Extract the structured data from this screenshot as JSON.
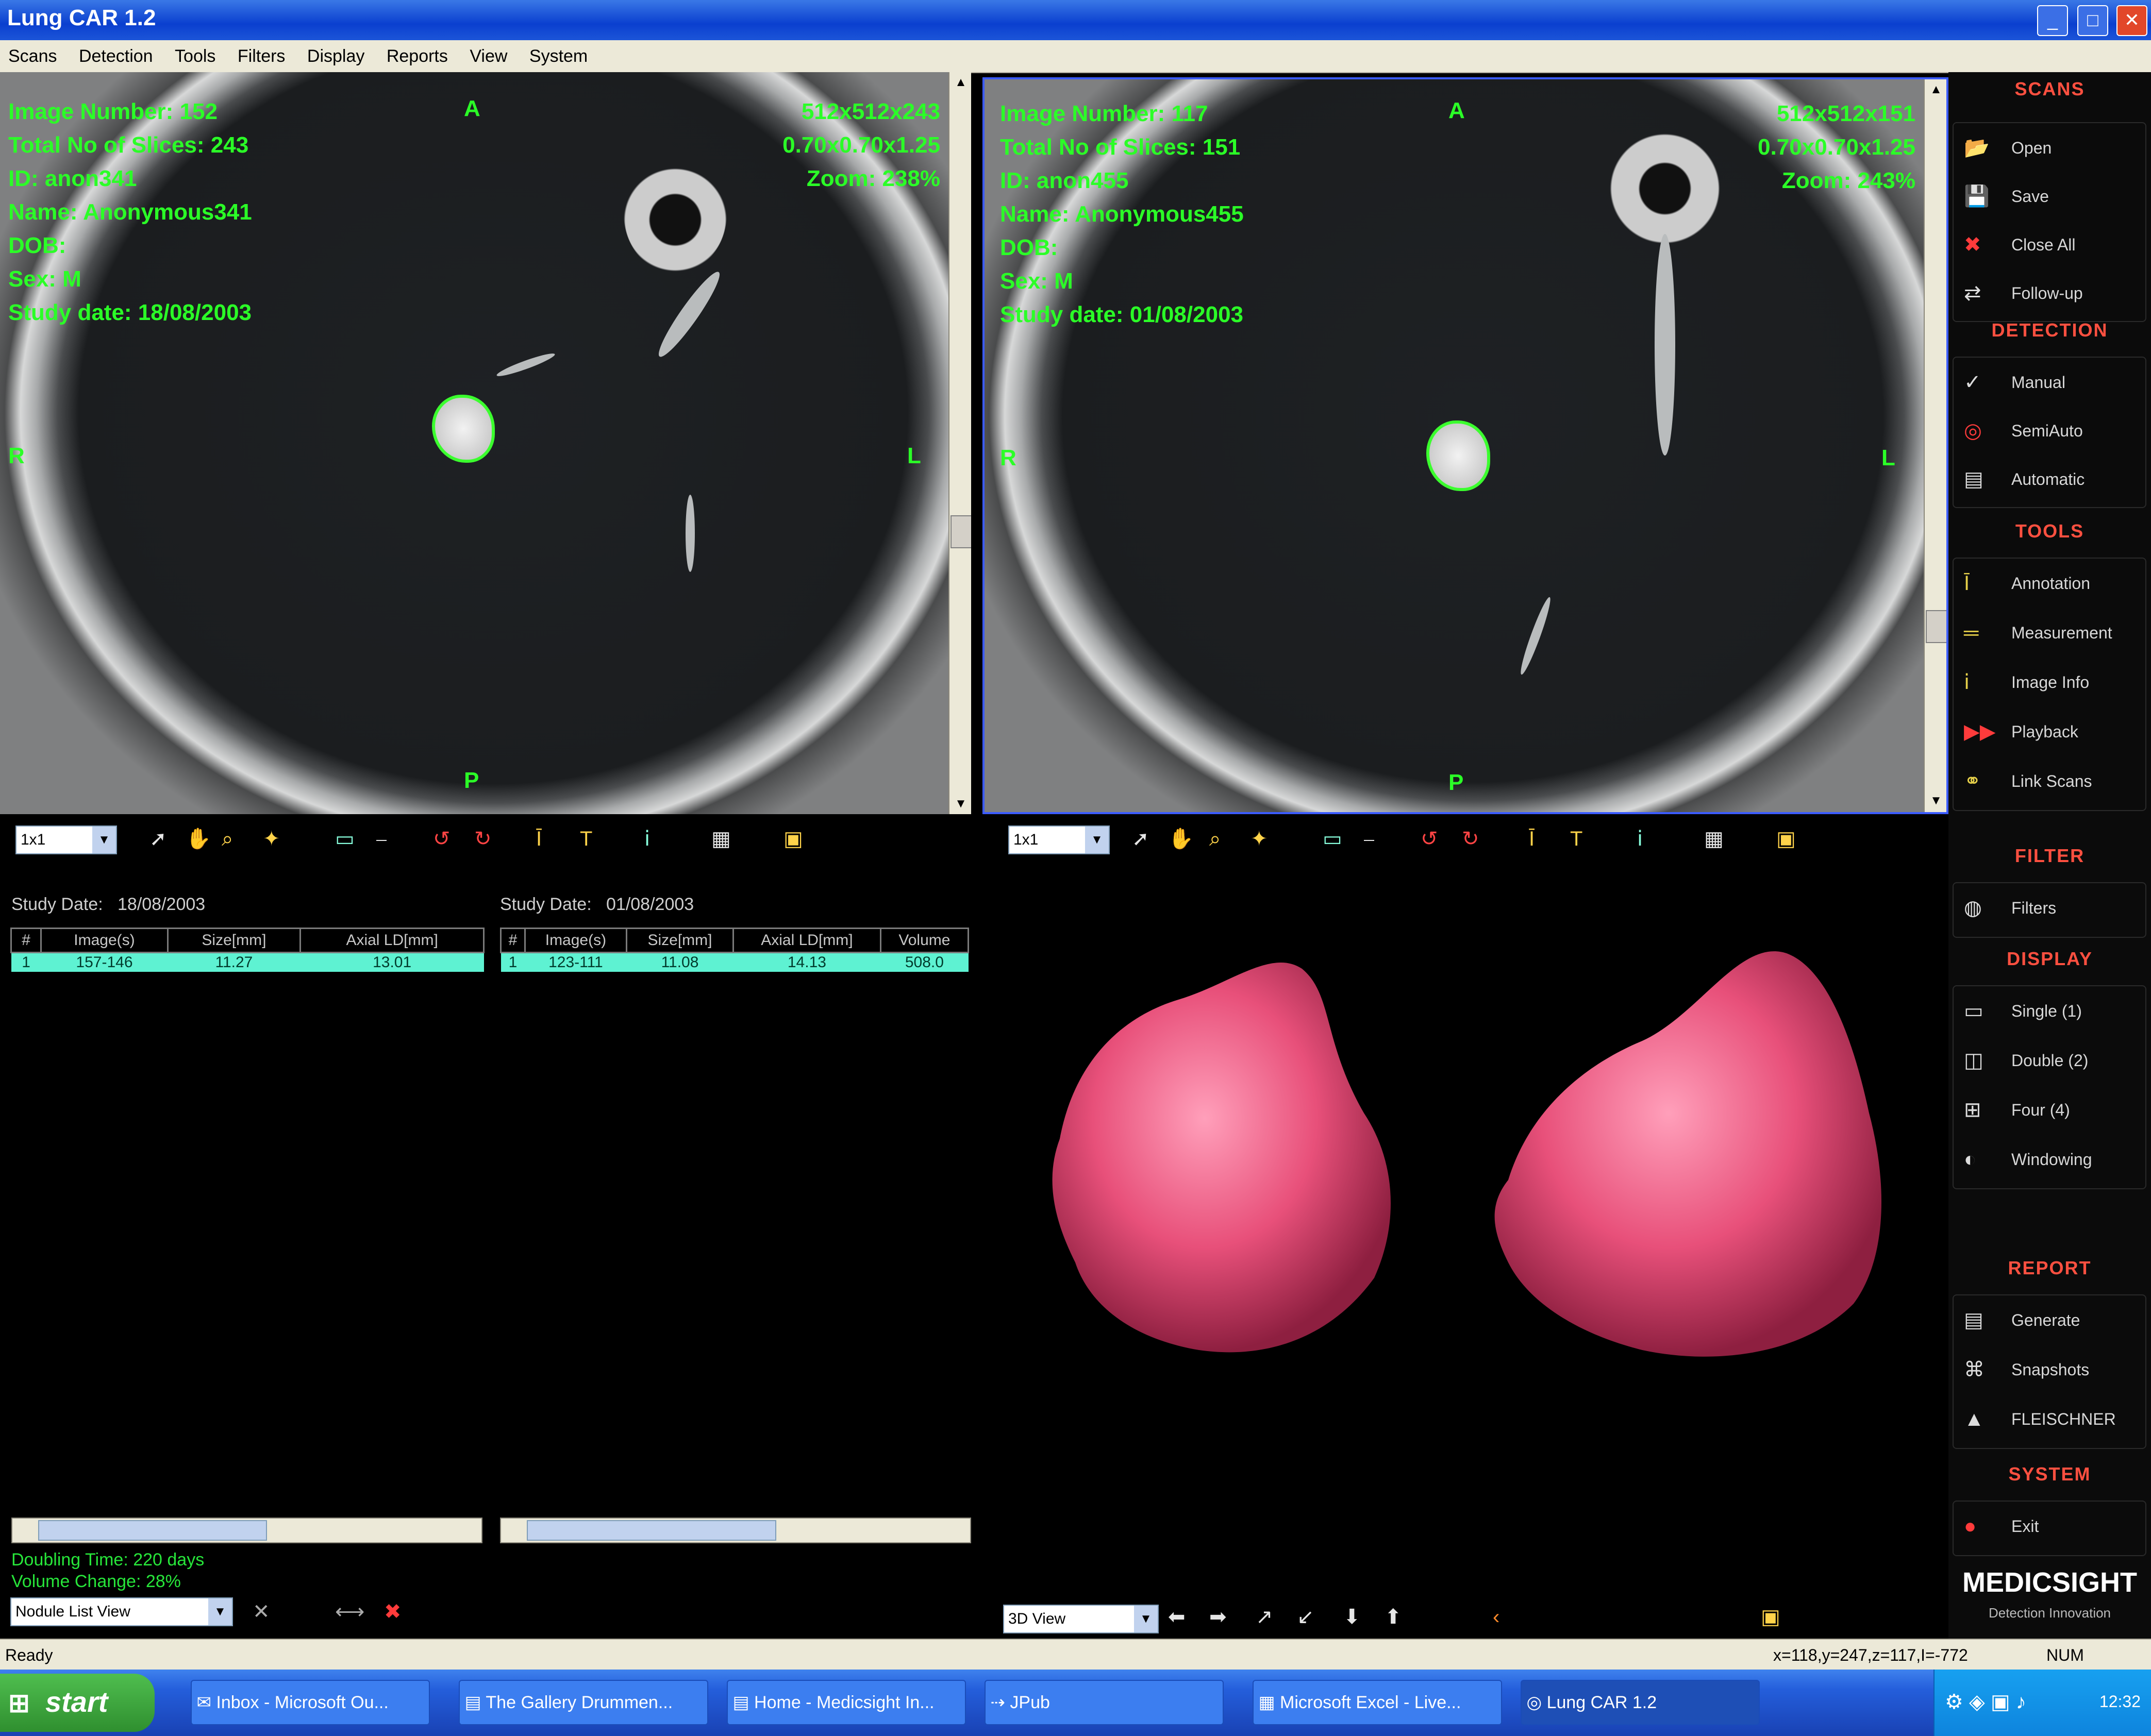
{
  "window": {
    "title": "Lung CAR 1.2",
    "buttons": [
      "_",
      "□",
      "✕"
    ]
  },
  "menu": [
    "Scans",
    "Detection",
    "Tools",
    "Filters",
    "Display",
    "Reports",
    "View",
    "System"
  ],
  "viewer_left": {
    "overlay_left": [
      "Image Number: 152",
      "Total No of Slices: 243",
      "ID: anon341",
      "Name: Anonymous341",
      "DOB:",
      "Sex: M",
      "Study date: 18/08/2003"
    ],
    "overlay_right": [
      "512x512x243",
      "0.70x0.70x1.25",
      "Zoom: 238%"
    ],
    "orient": {
      "top": "A",
      "left": "R",
      "right": "L",
      "bottom": "P"
    },
    "zoom_select": "1x1"
  },
  "viewer_right": {
    "overlay_left": [
      "Image Number: 117",
      "Total No of Slices: 151",
      "ID: anon455",
      "Name: Anonymous455",
      "DOB:",
      "Sex: M",
      "Study date: 01/08/2003"
    ],
    "overlay_right": [
      "512x512x151",
      "0.70x0.70x1.25",
      "Zoom: 243%"
    ],
    "orient": {
      "top": "A",
      "left": "R",
      "right": "L",
      "bottom": "P"
    },
    "zoom_select": "1x1"
  },
  "sidebar": {
    "scans": {
      "title": "SCANS",
      "items": [
        {
          "label": "Open",
          "icon": "folder-open-icon",
          "glyph": "📂"
        },
        {
          "label": "Save",
          "icon": "save-icon",
          "glyph": "💾"
        },
        {
          "label": "Close All",
          "icon": "close-icon",
          "glyph": "✖"
        },
        {
          "label": "Follow-up",
          "icon": "follow-up-icon",
          "glyph": "⇄"
        }
      ]
    },
    "detection": {
      "title": "DETECTION",
      "items": [
        {
          "label": "Manual",
          "icon": "manual-icon",
          "glyph": "✓"
        },
        {
          "label": "SemiAuto",
          "icon": "semi-auto-icon",
          "glyph": "◎"
        },
        {
          "label": "Automatic",
          "icon": "automatic-icon",
          "glyph": "▤"
        }
      ]
    },
    "tools": {
      "title": "TOOLS",
      "items": [
        {
          "label": "Annotation",
          "icon": "annotation-icon",
          "glyph": "Ī"
        },
        {
          "label": "Measurement",
          "icon": "measurement-icon",
          "glyph": "═"
        },
        {
          "label": "Image Info",
          "icon": "image-info-icon",
          "glyph": "ⅰ"
        },
        {
          "label": "Playback",
          "icon": "playback-icon",
          "glyph": "▶▶"
        },
        {
          "label": "Link Scans",
          "icon": "link-scans-icon",
          "glyph": "⚭"
        }
      ]
    },
    "filter": {
      "title": "FILTER",
      "items": [
        {
          "label": "Filters",
          "icon": "filter-icon",
          "glyph": "◍"
        }
      ]
    },
    "display": {
      "title": "DISPLAY",
      "items": [
        {
          "label": "Single (1)",
          "icon": "single-view-icon",
          "glyph": "▭"
        },
        {
          "label": "Double (2)",
          "icon": "double-view-icon",
          "glyph": "◫"
        },
        {
          "label": "Four (4)",
          "icon": "four-view-icon",
          "glyph": "⊞"
        },
        {
          "label": "Windowing",
          "icon": "windowing-icon",
          "glyph": "◐"
        }
      ]
    },
    "report": {
      "title": "REPORT",
      "items": [
        {
          "label": "Generate",
          "icon": "generate-report-icon",
          "glyph": "▤"
        },
        {
          "label": "Snapshots",
          "icon": "snapshots-icon",
          "glyph": "⌘"
        },
        {
          "label": "FLEISCHNER",
          "icon": "fleischner-icon",
          "glyph": "▲"
        }
      ]
    },
    "system": {
      "title": "SYSTEM",
      "items": [
        {
          "label": "Exit",
          "icon": "exit-icon",
          "glyph": "●"
        }
      ]
    },
    "logo": {
      "text": "MEDICSIGHT",
      "tagline": "Detection Innovation"
    }
  },
  "study_left": {
    "date_label": "Study Date:",
    "date": "18/08/2003",
    "columns": [
      "#",
      "Image(s)",
      "Size[mm]",
      "Axial LD[mm]"
    ],
    "rows": [
      [
        "1",
        "157-146",
        "11.27",
        "13.01"
      ]
    ]
  },
  "study_right": {
    "date_label": "Study Date:",
    "date": "01/08/2003",
    "columns": [
      "#",
      "Image(s)",
      "Size[mm]",
      "Axial LD[mm]",
      "Volume"
    ],
    "rows": [
      [
        "1",
        "123-111",
        "11.08",
        "14.13",
        "508.0"
      ]
    ]
  },
  "summary": {
    "doubling_time": "Doubling Time: 220 days",
    "volume_change": "Volume Change: 28%"
  },
  "nodule_list_select": "Nodule List View",
  "view3d_select": "3D View",
  "status": {
    "left": "Ready",
    "coords": "x=118,y=247,z=117,I=-772",
    "mode": "NUM"
  },
  "taskbar": {
    "start": "start",
    "tasks": [
      "Inbox - Microsoft Ou...",
      "The Gallery Drummen...",
      "Home - Medicsight In...",
      "JPub",
      "Microsoft Excel - Live...",
      "Lung CAR 1.2"
    ],
    "clock": "12:32"
  }
}
